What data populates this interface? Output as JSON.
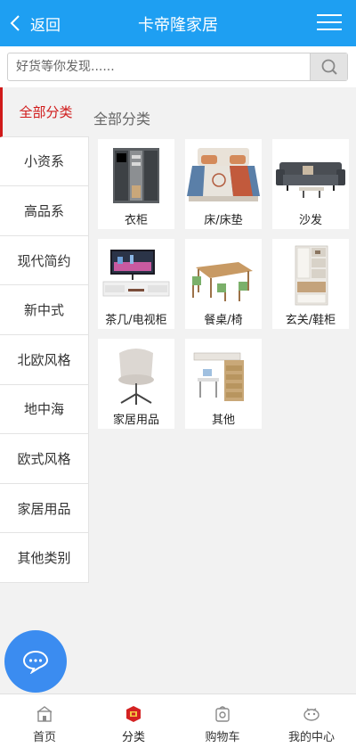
{
  "header": {
    "back_label": "返回",
    "title": "卡帝隆家居"
  },
  "search": {
    "placeholder": "好货等你发现......"
  },
  "sidebar": {
    "items": [
      {
        "label": "全部分类",
        "active": true
      },
      {
        "label": "小资系"
      },
      {
        "label": "高品系"
      },
      {
        "label": "现代简约"
      },
      {
        "label": "新中式"
      },
      {
        "label": "北欧风格"
      },
      {
        "label": "地中海"
      },
      {
        "label": "欧式风格"
      },
      {
        "label": "家居用品"
      },
      {
        "label": "其他类别"
      }
    ]
  },
  "main": {
    "section_title": "全部分类",
    "categories": [
      {
        "label": "衣柜",
        "icon": "wardrobe-icon"
      },
      {
        "label": "床/床垫",
        "icon": "bed-icon"
      },
      {
        "label": "沙发",
        "icon": "sofa-icon"
      },
      {
        "label": "茶几/电视柜",
        "icon": "tv-cabinet-icon"
      },
      {
        "label": "餐桌/椅",
        "icon": "dining-table-icon"
      },
      {
        "label": "玄关/鞋柜",
        "icon": "shoe-cabinet-icon"
      },
      {
        "label": "家居用品",
        "icon": "chair-icon"
      },
      {
        "label": "其他",
        "icon": "bunk-bed-icon"
      }
    ]
  },
  "tabbar": {
    "items": [
      {
        "label": "首页",
        "icon": "home-icon"
      },
      {
        "label": "分类",
        "icon": "category-icon",
        "active": true
      },
      {
        "label": "购物车",
        "icon": "cart-icon"
      },
      {
        "label": "我的中心",
        "icon": "user-icon"
      }
    ]
  },
  "colors": {
    "header": "#1e9ff2",
    "active": "#d01a1a",
    "fab": "#3b8cf0"
  }
}
